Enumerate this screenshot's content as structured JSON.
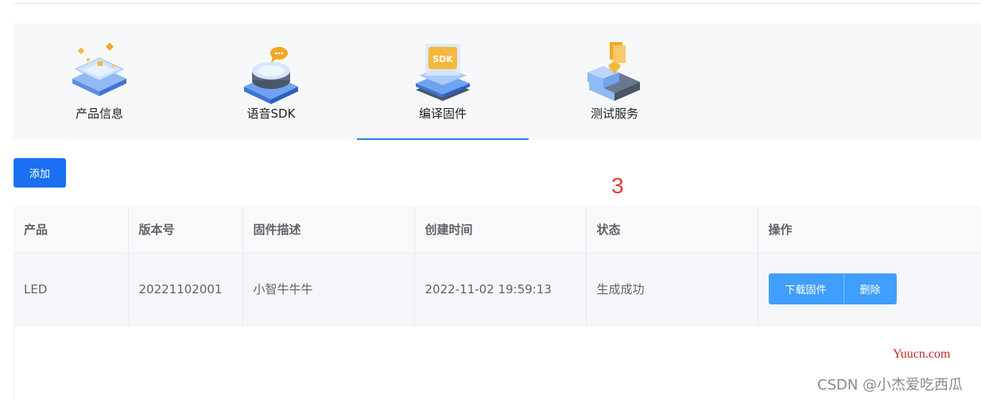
{
  "steps": [
    {
      "label": "产品信息",
      "icon": "product-info-icon",
      "active": false
    },
    {
      "label": "语音SDK",
      "icon": "voice-sdk-icon",
      "active": false
    },
    {
      "label": "编译固件",
      "icon": "compile-firmware-icon",
      "sdk_text": "SDK",
      "active": true
    },
    {
      "label": "测试服务",
      "icon": "test-service-icon",
      "active": false
    }
  ],
  "toolbar": {
    "add_label": "添加"
  },
  "annotation": {
    "number": "3"
  },
  "table": {
    "columns": [
      "产品",
      "版本号",
      "固件描述",
      "创建时间",
      "状态",
      "操作"
    ],
    "rows": [
      {
        "product": "LED",
        "version": "20221102001",
        "description": "小智牛牛牛",
        "created_at": "2022-11-02 19:59:13",
        "status": "生成成功",
        "actions": {
          "download": "下载固件",
          "delete": "删除"
        }
      }
    ]
  },
  "watermarks": {
    "site": "Yuucn.com",
    "csdn": "CSDN @小杰爱吃西瓜"
  },
  "colors": {
    "primary": "#1a70f0",
    "action_button": "#409eff",
    "active_underline": "#2d7ef2",
    "annotation": "#e53935"
  }
}
